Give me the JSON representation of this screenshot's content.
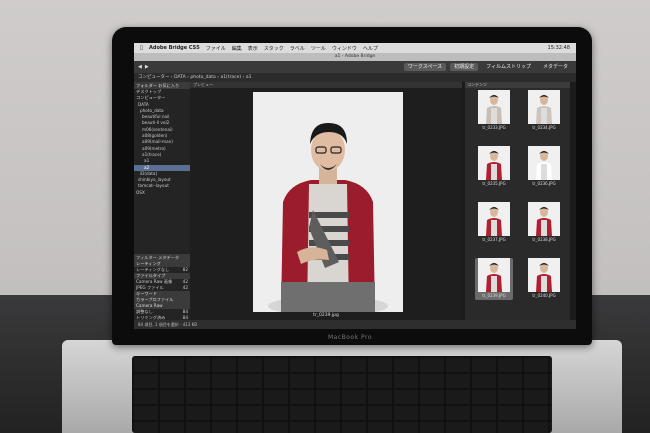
{
  "menubar": {
    "app": "Adobe Bridge CS5",
    "items": [
      "ファイル",
      "編集",
      "表示",
      "スタック",
      "ラベル",
      "ツール",
      "ウィンドウ",
      "ヘルプ"
    ],
    "clock": "15:32:48"
  },
  "window": {
    "title": "a1 - Adobe Bridge"
  },
  "toolbar": {
    "workspace": "ワークスペース",
    "tab_essentials": "初期設定",
    "tab_filmstrip": "フィルムストリップ",
    "tab_metadata": "メタデータ"
  },
  "path": "コンピューター › DATA › photo_data › a1(trace) › a1",
  "left_panel": {
    "header": "フォルダー  お気に入り",
    "items": [
      "デスクトップ",
      "コンピューター",
      "DATA",
      "photo_data",
      "beautiful nail",
      "beauti-ll vol2",
      "m06(sentenai)",
      "a08(golden)",
      "a09(mail-man)",
      "a09(metro)",
      "a1(trace)",
      "a1",
      "a2",
      "iD(data)",
      "shinbiyo_layout",
      "tomcat--layout",
      "OSX"
    ],
    "selected": "a2"
  },
  "metadata": {
    "header": "フィルター  メタデータ",
    "sections": [
      {
        "title": "レーティング",
        "rows": [
          {
            "label": "レーティングなし",
            "value": "82"
          }
        ]
      },
      {
        "title": "ファイルタイプ",
        "rows": [
          {
            "label": "Camera Raw 画像",
            "value": "42"
          },
          {
            "label": "JPEG ファイル",
            "value": "42"
          }
        ]
      },
      {
        "title": "キーワード",
        "rows": []
      },
      {
        "title": "カラープロファイル",
        "rows": []
      },
      {
        "title": "Camera Raw",
        "rows": [
          {
            "label": "調整なし",
            "value": "84"
          },
          {
            "label": "トリミング済み",
            "value": "84"
          }
        ]
      }
    ]
  },
  "preview": {
    "header": "プレビュー",
    "caption": "tr_0239.jpg"
  },
  "content": {
    "header": "コンテンツ",
    "thumbs": [
      "tr_0233.JPG",
      "tr_0234.JPG",
      "tr_0235.JPG",
      "tr_0236.JPG",
      "tr_0237.JPG",
      "tr_0238.JPG",
      "tr_0239.JPG",
      "tr_0240.JPG"
    ],
    "selected": "tr_0239.JPG"
  },
  "status": "84 項目, 1 項目を選択 - 413 KB",
  "hardware": {
    "brand": "MacBook Pro"
  }
}
